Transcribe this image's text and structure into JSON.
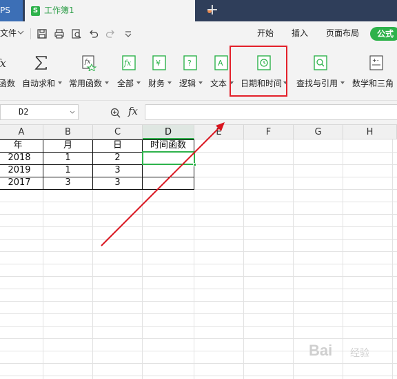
{
  "titlebar": {
    "app_tab_label": "PS",
    "doc_tab_icon_letter": "S",
    "doc_tab_title": "工作簿1",
    "new_tab_glyph": "+"
  },
  "quickbar": {
    "file_label": "文件",
    "menus": [
      "开始",
      "插入",
      "页面布局",
      "公式"
    ],
    "active_menu": "公式"
  },
  "ribbon": {
    "buttons": [
      {
        "label": "函数",
        "icon": "insert-function-icon"
      },
      {
        "label": "自动求和",
        "icon": "sigma-icon",
        "dropdown": true
      },
      {
        "label": "常用函数",
        "icon": "common-functions-icon",
        "dropdown": true
      },
      {
        "label": "全部",
        "icon": "fx-all-icon",
        "dropdown": true
      },
      {
        "label": "财务",
        "icon": "finance-icon",
        "dropdown": true
      },
      {
        "label": "逻辑",
        "icon": "logic-icon",
        "dropdown": true
      },
      {
        "label": "文本",
        "icon": "text-function-icon",
        "dropdown": true
      },
      {
        "label": "日期和时间",
        "icon": "date-time-icon",
        "dropdown": true
      },
      {
        "label": "查找与引用",
        "icon": "lookup-reference-icon",
        "dropdown": true
      },
      {
        "label": "数学和三角",
        "icon": "math-trig-icon",
        "dropdown": false
      }
    ],
    "highlighted_button": "日期和时间"
  },
  "formula_bar": {
    "name_box": "D2",
    "fx_label": "fx",
    "formula_value": ""
  },
  "grid": {
    "columns": [
      "A",
      "B",
      "C",
      "D",
      "E",
      "F",
      "G",
      "H"
    ],
    "active_column": "D",
    "header_row": [
      "年",
      "月",
      "日",
      "时间函数"
    ],
    "rows": [
      [
        "2018",
        "1",
        "2",
        ""
      ],
      [
        "2019",
        "1",
        "3",
        ""
      ],
      [
        "2017",
        "3",
        "3",
        ""
      ]
    ],
    "selected_cell": "D2"
  },
  "watermark": {
    "brand": "Bai",
    "suffix": "经验"
  },
  "colors": {
    "titlebar": "#2f3e5a",
    "accent_green": "#2eb24b",
    "highlight_red": "#e3202a",
    "arrow_red": "#d9141e"
  }
}
